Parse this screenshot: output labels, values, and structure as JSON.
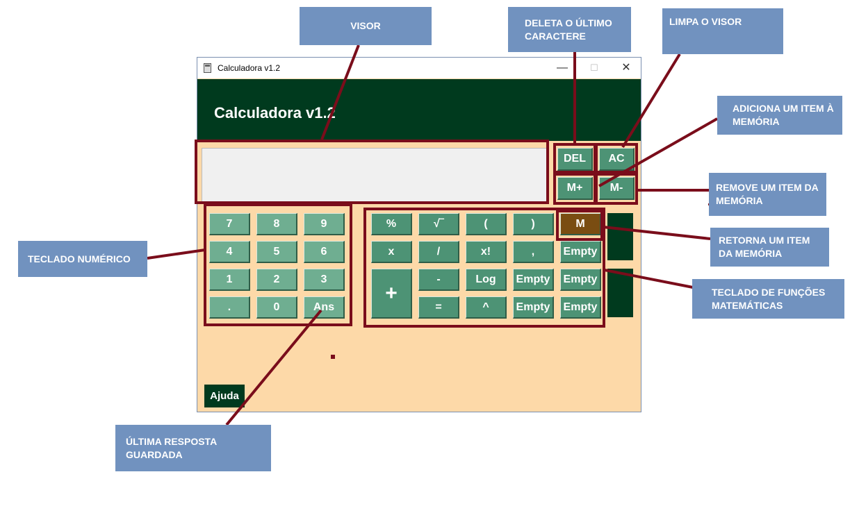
{
  "window": {
    "title": "Calculadora v1.2",
    "controls": {
      "minimize": "—",
      "maximize": "☐",
      "close": "✕"
    }
  },
  "header": {
    "title": "Calculadora v1.2"
  },
  "display": {
    "value": ""
  },
  "control_keys": {
    "del": "DEL",
    "ac": "AC",
    "mplus": "M+",
    "mminus": "M-"
  },
  "numeric_keys": [
    "7",
    "8",
    "9",
    "4",
    "5",
    "6",
    "1",
    "2",
    "3",
    ".",
    "0",
    "Ans"
  ],
  "function_keys": {
    "percent": "%",
    "sqrt": "√‾",
    "lparen": "(",
    "rparen": ")",
    "memory": "M",
    "times": "x",
    "divide": "/",
    "factorial": "x!",
    "comma": ",",
    "empty1": "Empty",
    "plus": "+",
    "minus": "-",
    "log": "Log",
    "empty2": "Empty",
    "empty3": "Empty",
    "equals": "=",
    "power": "^",
    "empty4": "Empty",
    "empty5": "Empty"
  },
  "help_button": "Ajuda",
  "annotations": {
    "visor": "VISOR",
    "delete": "DELETA O ÚLTIMO CARACTERE",
    "clear": "LIMPA O VISOR",
    "add_memory": "ADICIONA UM ITEM À MEMÓRIA",
    "remove_memory": "REMOVE UM ITEM DA MEMÓRIA",
    "recall_memory": "RETORNA UM ITEM DA MEMÓRIA",
    "numeric_keypad": "TECLADO NUMÉRICO",
    "math_keypad": "TECLADO DE FUNÇÕES MATEMÁTICAS",
    "last_answer": "ÚLTIMA RESPOSTA GUARDADA"
  },
  "colors": {
    "header": "#003a1e",
    "window_bg": "#fdd9a8",
    "numeric_key": "#6fae91",
    "function_key": "#4d9375",
    "memory_key": "#7a4d12",
    "annotation_box": "#7192bf",
    "annotation_line": "#7a0d1b"
  }
}
